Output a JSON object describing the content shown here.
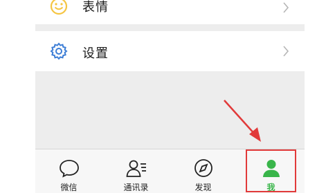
{
  "menu": {
    "emoji_label": "表情",
    "settings_label": "设置"
  },
  "tabbar": {
    "tabs": [
      {
        "label": "微信",
        "icon": "chat-bubble-icon",
        "active": false
      },
      {
        "label": "通讯录",
        "icon": "contacts-icon",
        "active": false
      },
      {
        "label": "发现",
        "icon": "compass-icon",
        "active": false
      },
      {
        "label": "我",
        "icon": "person-icon",
        "active": true
      }
    ]
  },
  "colors": {
    "accent_green": "#39b54a",
    "emoji_yellow": "#f5c542",
    "settings_blue": "#3d7ed6",
    "annotation_red": "#e13a3a",
    "background_gray": "#ededed"
  }
}
